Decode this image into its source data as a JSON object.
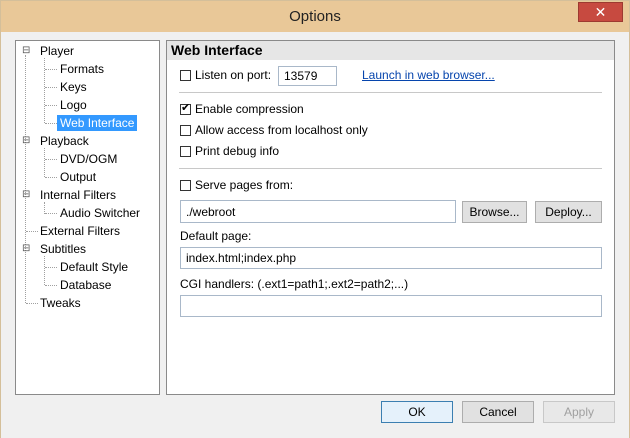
{
  "window": {
    "title": "Options",
    "close_glyph": "✕"
  },
  "tree": {
    "items": [
      {
        "label": "Player",
        "expander": "⊟"
      },
      {
        "label": "Formats"
      },
      {
        "label": "Keys"
      },
      {
        "label": "Logo"
      },
      {
        "label": "Web Interface"
      },
      {
        "label": "Playback",
        "expander": "⊟"
      },
      {
        "label": "DVD/OGM"
      },
      {
        "label": "Output"
      },
      {
        "label": "Internal Filters",
        "expander": "⊟"
      },
      {
        "label": "Audio Switcher"
      },
      {
        "label": "External Filters"
      },
      {
        "label": "Subtitles",
        "expander": "⊟"
      },
      {
        "label": "Default Style"
      },
      {
        "label": "Database"
      },
      {
        "label": "Tweaks"
      }
    ],
    "selected_index": 4
  },
  "panel": {
    "title": "Web Interface",
    "listen_label": "Listen on port:",
    "listen_checked": false,
    "port_value": "13579",
    "launch_link": "Launch in web browser...",
    "enable_compression_label": "Enable compression",
    "enable_compression_checked": true,
    "localhost_label": "Allow access from localhost only",
    "localhost_checked": false,
    "debug_label": "Print debug info",
    "debug_checked": false,
    "serve_label": "Serve pages from:",
    "serve_checked": false,
    "serve_path": "./webroot",
    "browse_label": "Browse...",
    "deploy_label": "Deploy...",
    "default_page_label": "Default page:",
    "default_page_value": "index.html;index.php",
    "cgi_label": "CGI handlers: (.ext1=path1;.ext2=path2;...)",
    "cgi_value": ""
  },
  "footer": {
    "ok_label": "OK",
    "cancel_label": "Cancel",
    "apply_label": "Apply"
  }
}
